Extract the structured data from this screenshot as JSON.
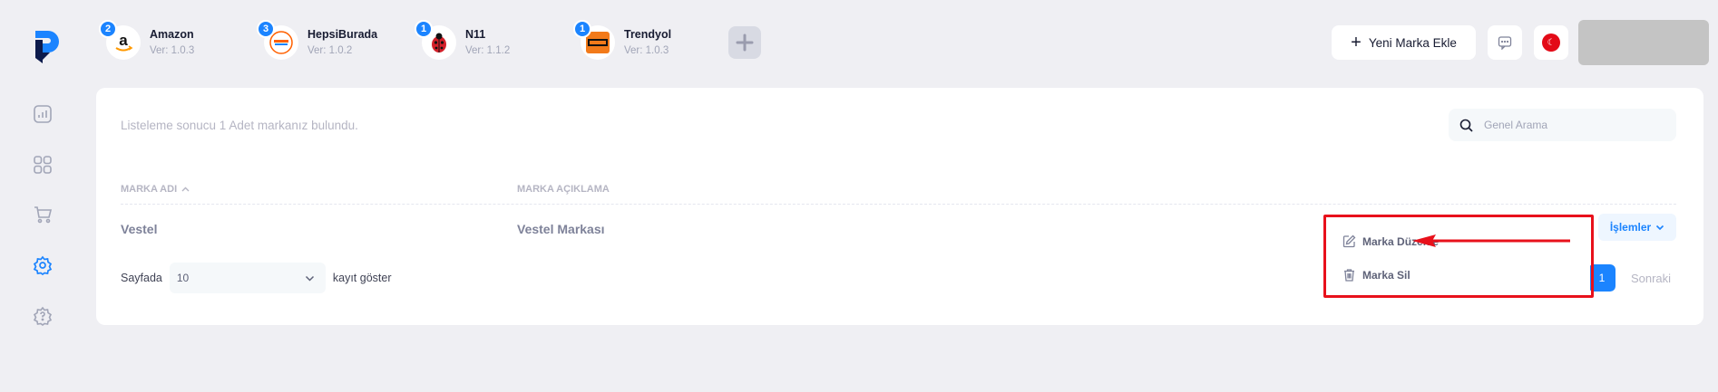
{
  "marketplaces": [
    {
      "name": "Amazon",
      "version": "Ver: 1.0.3",
      "badge": "2"
    },
    {
      "name": "HepsiBurada",
      "version": "Ver: 1.0.2",
      "badge": "3"
    },
    {
      "name": "N11",
      "version": "Ver: 1.1.2",
      "badge": "1"
    },
    {
      "name": "Trendyol",
      "version": "Ver: 1.0.3",
      "badge": "1"
    }
  ],
  "header": {
    "new_brand_label": "Yeni Marka Ekle"
  },
  "main": {
    "result_text": "Listeleme sonucu 1 Adet markanız bulundu.",
    "search_placeholder": "Genel Arama",
    "columns": [
      "MARKA ADI",
      "MARKA AÇIKLAMA"
    ],
    "rows": [
      {
        "name": "Vestel",
        "description": "Vestel Markası",
        "actions_label": "İşlemler"
      }
    ],
    "pager": {
      "prefix": "Sayfada",
      "page_size": "10",
      "suffix": "kayıt göster",
      "current_page": "1",
      "next_label": "Sonraki"
    }
  },
  "menu": {
    "items": [
      "Marka Düzenle",
      "Marka Sil"
    ]
  },
  "colors": {
    "accent": "#1b84ff",
    "annotation_red": "#e8111b",
    "background": "#efeff3"
  }
}
